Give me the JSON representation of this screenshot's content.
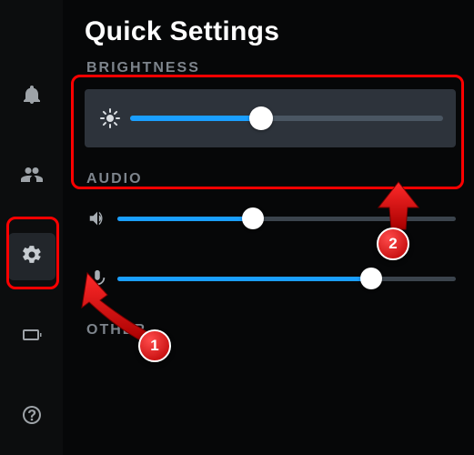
{
  "title": "Quick Settings",
  "sections": {
    "brightness": {
      "label": "BRIGHTNESS",
      "value_pct": 42
    },
    "audio": {
      "label": "AUDIO",
      "volume_pct": 40,
      "mic_pct": 75
    },
    "other": {
      "label": "OTHER"
    }
  },
  "sidebar": {
    "notifications": "notifications-icon",
    "friends": "friends-icon",
    "settings": "settings-icon",
    "battery": "battery-icon",
    "help": "help-icon"
  },
  "annotations": {
    "c1": "1",
    "c2": "2"
  }
}
